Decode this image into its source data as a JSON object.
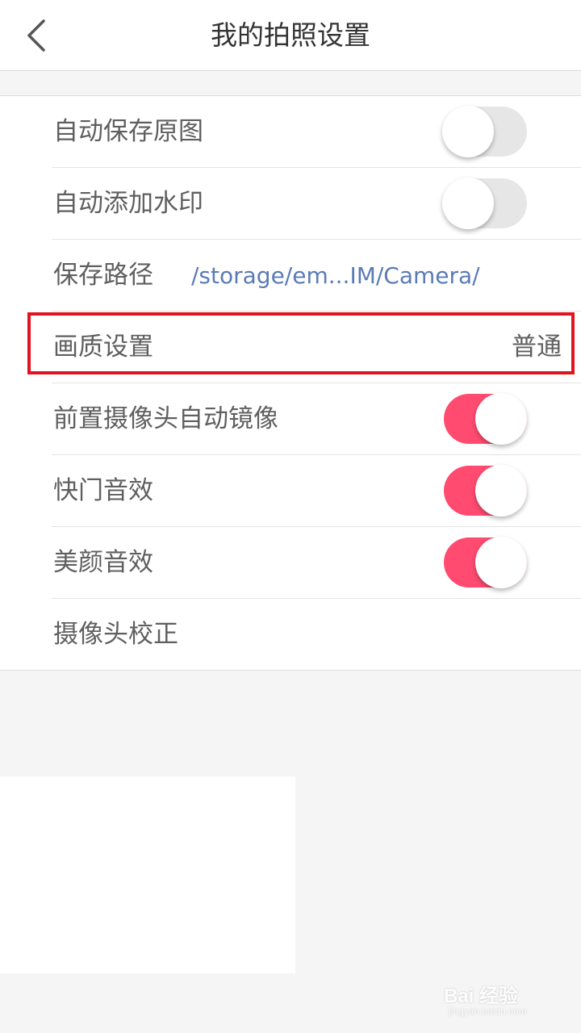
{
  "header": {
    "title": "我的拍照设置",
    "back_icon": "chevron-left-icon"
  },
  "settings": {
    "auto_save_original": {
      "label": "自动保存原图",
      "enabled": false
    },
    "auto_watermark": {
      "label": "自动添加水印",
      "enabled": false
    },
    "save_path": {
      "label": "保存路径",
      "value": "/storage/em...IM/Camera/"
    },
    "quality": {
      "label": "画质设置",
      "value": "普通"
    },
    "front_mirror": {
      "label": "前置摄像头自动镜像",
      "enabled": true
    },
    "shutter_sound": {
      "label": "快门音效",
      "enabled": true
    },
    "beauty_sound": {
      "label": "美颜音效",
      "enabled": true
    },
    "camera_calibration": {
      "label": "摄像头校正"
    }
  },
  "colors": {
    "toggle_on": "#ff4b70",
    "toggle_off": "#e6e6e6",
    "path_text": "#5b7bb5",
    "highlight": "#e0141e"
  },
  "watermark": {
    "logo": "Bai 经验",
    "url": "jingyan.baidu.com"
  }
}
